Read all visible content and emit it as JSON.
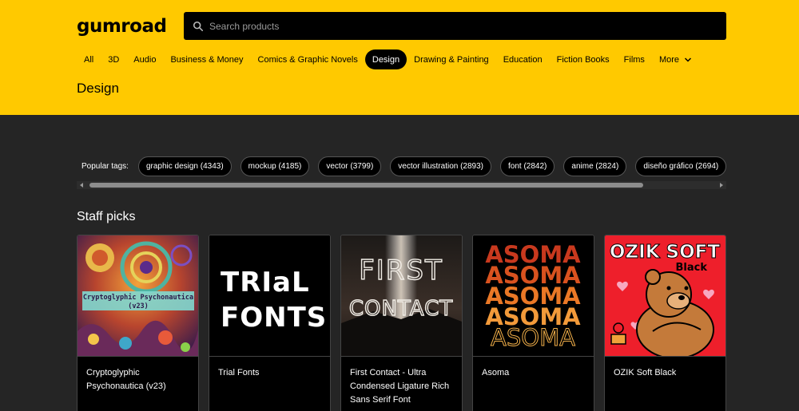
{
  "header": {
    "logo": "gumroad",
    "search_placeholder": "Search products"
  },
  "categories": [
    {
      "label": "All",
      "active": false
    },
    {
      "label": "3D",
      "active": false
    },
    {
      "label": "Audio",
      "active": false
    },
    {
      "label": "Business & Money",
      "active": false
    },
    {
      "label": "Comics & Graphic Novels",
      "active": false
    },
    {
      "label": "Design",
      "active": true
    },
    {
      "label": "Drawing & Painting",
      "active": false
    },
    {
      "label": "Education",
      "active": false
    },
    {
      "label": "Fiction Books",
      "active": false
    },
    {
      "label": "Films",
      "active": false
    }
  ],
  "more_label": "More",
  "page_title": "Design",
  "popular_tags": {
    "label": "Popular tags:",
    "tags": [
      "graphic design (4343)",
      "mockup (4185)",
      "vector (3799)",
      "vector illustration (2893)",
      "font (2842)",
      "anime (2824)",
      "diseño gráfico (2694)"
    ]
  },
  "staff_picks": {
    "title": "Staff picks",
    "products": [
      {
        "name": "Cryptoglyphic Psychonautica (v23)",
        "thumb_text": "Cryptoglyphic Psychonautica (v23)"
      },
      {
        "name": "Trial Fonts",
        "thumb_text": "TRIAL FONTS"
      },
      {
        "name": "First Contact - Ultra Condensed Ligature Rich Sans Serif Font",
        "thumb_text": "FIRST CONTACT"
      },
      {
        "name": "Asoma",
        "thumb_text": "ASOMA"
      },
      {
        "name": "OZIK Soft Black",
        "thumb_text": "OZIK SOFT",
        "thumb_sub": "Black"
      }
    ]
  },
  "colors": {
    "header_bg": "#ffc900",
    "page_bg": "#252525",
    "card_bg": "#000000"
  }
}
